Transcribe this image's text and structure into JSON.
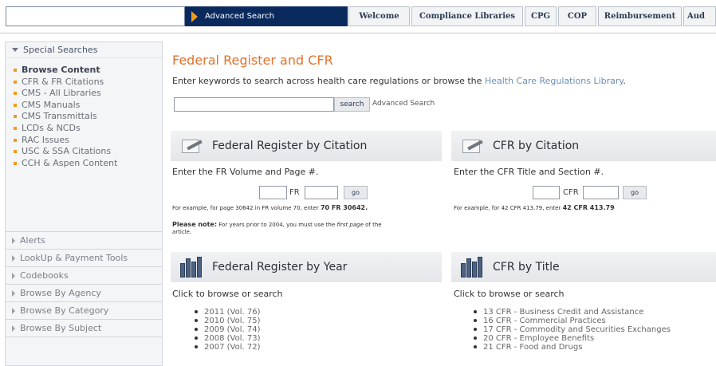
{
  "topnav": {
    "search_placeholder": "",
    "advanced_search": "Advanced Search",
    "tabs": [
      "Welcome",
      "Compliance Libraries",
      "CPG",
      "COP",
      "Reimbursement",
      "Aud"
    ]
  },
  "sidebar": {
    "special_header": "Special Searches",
    "special_items": [
      "Browse Content",
      "CFR & FR Citations",
      "CMS - All Libraries",
      "CMS Manuals",
      "CMS Transmittals",
      "LCDs & NCDs",
      "RAC Issues",
      "USC & SSA Citations",
      "CCH & Aspen Content"
    ],
    "sections": [
      "Alerts",
      "LookUp & Payment Tools",
      "Codebooks",
      "Browse By Agency",
      "Browse By Category",
      "Browse By Subject"
    ]
  },
  "main": {
    "title": "Federal Register and CFR",
    "desc_prefix": "Enter keywords to search across health care regulations or browse the ",
    "desc_link": "Health Care Regulations Library",
    "desc_suffix": ".",
    "search_button": "search",
    "advanced_search": "Advanced Search"
  },
  "fr_citation": {
    "title": "Federal Register by Citation",
    "instruction": "Enter the FR Volume and Page #.",
    "field_label": "FR",
    "go": "go",
    "example_prefix": "For example, for page 30642 in FR volume 70, enter ",
    "example_bold": "70 FR 30642.",
    "note_bold": "Please note:",
    "note_text": "For years prior to 2004, you must use the",
    "note_italic": "first page",
    "note_text2": "of the",
    "note_text3": "article."
  },
  "cfr_citation": {
    "title": "CFR by Citation",
    "instruction": "Enter the CFR Title and Section #.",
    "field_label": "CFR",
    "go": "go",
    "example_prefix": "For example, for 42 CFR 413.79, enter ",
    "example_bold": "42 CFR 413.79"
  },
  "fr_year": {
    "title": "Federal Register by Year",
    "instruction": "Click to browse or search",
    "items": [
      "2011 (Vol. 76)",
      "2010 (Vol. 75)",
      "2009 (Vol. 74)",
      "2008 (Vol. 73)",
      "2007 (Vol. 72)"
    ]
  },
  "cfr_title": {
    "title": "CFR by Title",
    "instruction": "Click to browse or search",
    "items": [
      "13 CFR - Business Credit and Assistance",
      "16 CFR - Commercial Practices",
      "17 CFR - Commodity and Securities Exchanges",
      "20 CFR - Employee Benefits",
      "21 CFR - Food and Drugs"
    ]
  }
}
